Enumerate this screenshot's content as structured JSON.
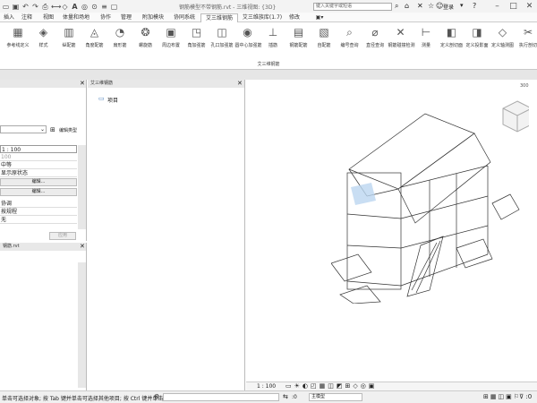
{
  "title": {
    "text": "钢筋模型不带钢筋.rvt - 三维视图: {3D}",
    "search_placeholder": "键入关键字或短语",
    "login": "登录"
  },
  "menu": [
    "插入",
    "注释",
    "视图",
    "体量和场地",
    "协作",
    "管理",
    "附加模块",
    "协同系统",
    "艾三维钢筋",
    "艾三维族库(1.7)",
    "修改"
  ],
  "active_menu": "艾三维钢筋",
  "ribbon": {
    "buttons": [
      {
        "label": "参考线定义",
        "icon": "▦"
      },
      {
        "label": "样式",
        "icon": "◈"
      },
      {
        "label": "纵配筋",
        "icon": "▥"
      },
      {
        "label": "角度配筋",
        "icon": "◬"
      },
      {
        "label": "扇形筋",
        "icon": "◔"
      },
      {
        "label": "螺旋筋",
        "icon": "❂"
      },
      {
        "label": "周边布置",
        "icon": "▣"
      },
      {
        "label": "角加强筋",
        "icon": "◳"
      },
      {
        "label": "孔口加强筋",
        "icon": "◫"
      },
      {
        "label": "圆中心加强筋",
        "icon": "◉"
      },
      {
        "label": "插筋",
        "icon": "⊥"
      },
      {
        "label": "钢筋配筋",
        "icon": "▤"
      },
      {
        "label": "自配筋",
        "icon": "▧"
      },
      {
        "label": "编号查询",
        "icon": "⌕"
      },
      {
        "label": "直径查询",
        "icon": "⌀"
      },
      {
        "label": "钢筋碰撞检测",
        "icon": "✕"
      },
      {
        "label": "测量",
        "icon": "⊢"
      },
      {
        "label": "定义剖切面",
        "icon": "◧"
      },
      {
        "label": "定义投影面",
        "icon": "◨"
      },
      {
        "label": "定义轴测图",
        "icon": "◇"
      },
      {
        "label": "执行剖切",
        "icon": "✂"
      }
    ],
    "group": "艾三维钢筋"
  },
  "properties": {
    "header": "",
    "edit_type": "编辑类型",
    "rows": [
      "1 : 100",
      "100",
      "中等",
      "显示原状态"
    ],
    "edit_btn_1": "编辑...",
    "edit_btn_2": "编辑...",
    "rows2": [
      "协调",
      "按规程",
      "无"
    ],
    "apply": "应用"
  },
  "browser": {
    "title": "钢筋.rvt"
  },
  "project_panel": {
    "title": "艾三维钢筋",
    "root": "项目"
  },
  "view": {
    "scale": "1 : 100",
    "orientation": "300 ×"
  },
  "status": {
    "text": "单击可选择对象; 按 Tab 键并单击可选择其他项目; 按 Ctrl 键并单击可将新项目添加到选择集",
    "model": "主模型",
    "zero": ":0"
  }
}
